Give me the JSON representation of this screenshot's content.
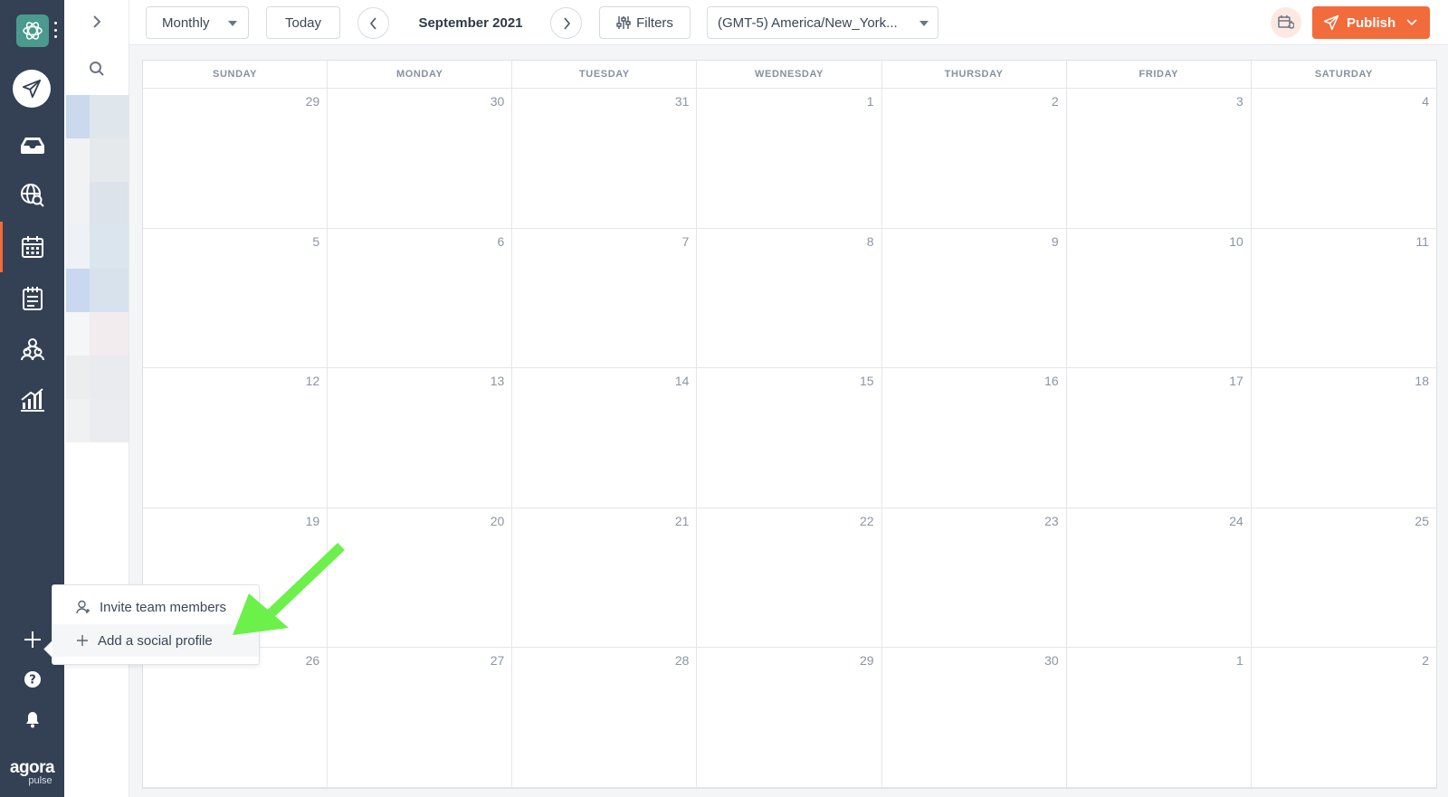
{
  "nav": {
    "items": [
      "compose",
      "inbox",
      "listening",
      "calendar",
      "planner",
      "users",
      "reports"
    ],
    "bottom": [
      "add-icon",
      "help-icon",
      "bell-icon"
    ],
    "brand_line1": "agora",
    "brand_line2": "pulse"
  },
  "toolbar": {
    "view_label": "Monthly",
    "today_label": "Today",
    "month_label": "September 2021",
    "filters_label": "Filters",
    "timezone_label": "(GMT-5) America/New_York...",
    "publish_label": "Publish"
  },
  "calendar": {
    "weekdays": [
      "SUNDAY",
      "MONDAY",
      "TUESDAY",
      "WEDNESDAY",
      "THURSDAY",
      "FRIDAY",
      "SATURDAY"
    ],
    "weeks": [
      [
        "29",
        "30",
        "31",
        "1",
        "2",
        "3",
        "4"
      ],
      [
        "5",
        "6",
        "7",
        "8",
        "9",
        "10",
        "11"
      ],
      [
        "12",
        "13",
        "14",
        "15",
        "16",
        "17",
        "18"
      ],
      [
        "19",
        "20",
        "21",
        "22",
        "23",
        "24",
        "25"
      ],
      [
        "26",
        "27",
        "28",
        "29",
        "30",
        "1",
        "2"
      ]
    ]
  },
  "popup": {
    "invite_label": "Invite team members",
    "add_profile_label": "Add a social profile"
  },
  "colors": {
    "nav_bg": "#344154",
    "accent": "#f26b3a",
    "annotation_arrow": "#6cf04a"
  }
}
